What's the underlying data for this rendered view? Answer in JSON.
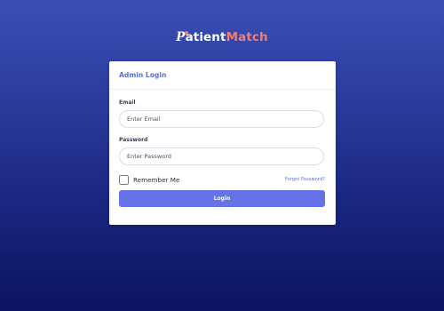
{
  "logo": {
    "p_letter": "P",
    "rest": "atient",
    "match": "Match",
    "text_color": "#ffffff",
    "accent_color": "#f07f73"
  },
  "card": {
    "title": "Admin Login",
    "email": {
      "label": "Email",
      "placeholder": "Enter Email",
      "value": ""
    },
    "password": {
      "label": "Password",
      "placeholder": "Enter Password",
      "value": ""
    },
    "remember_label": "Remember Me",
    "remember_checked": false,
    "forgot_link": "Forgot Password?",
    "login_label": "Login"
  },
  "colors": {
    "primary": "#6673e8",
    "link": "#5b6fe0",
    "background_top": "#3a4fb5",
    "background_bottom": "#0c1460"
  }
}
